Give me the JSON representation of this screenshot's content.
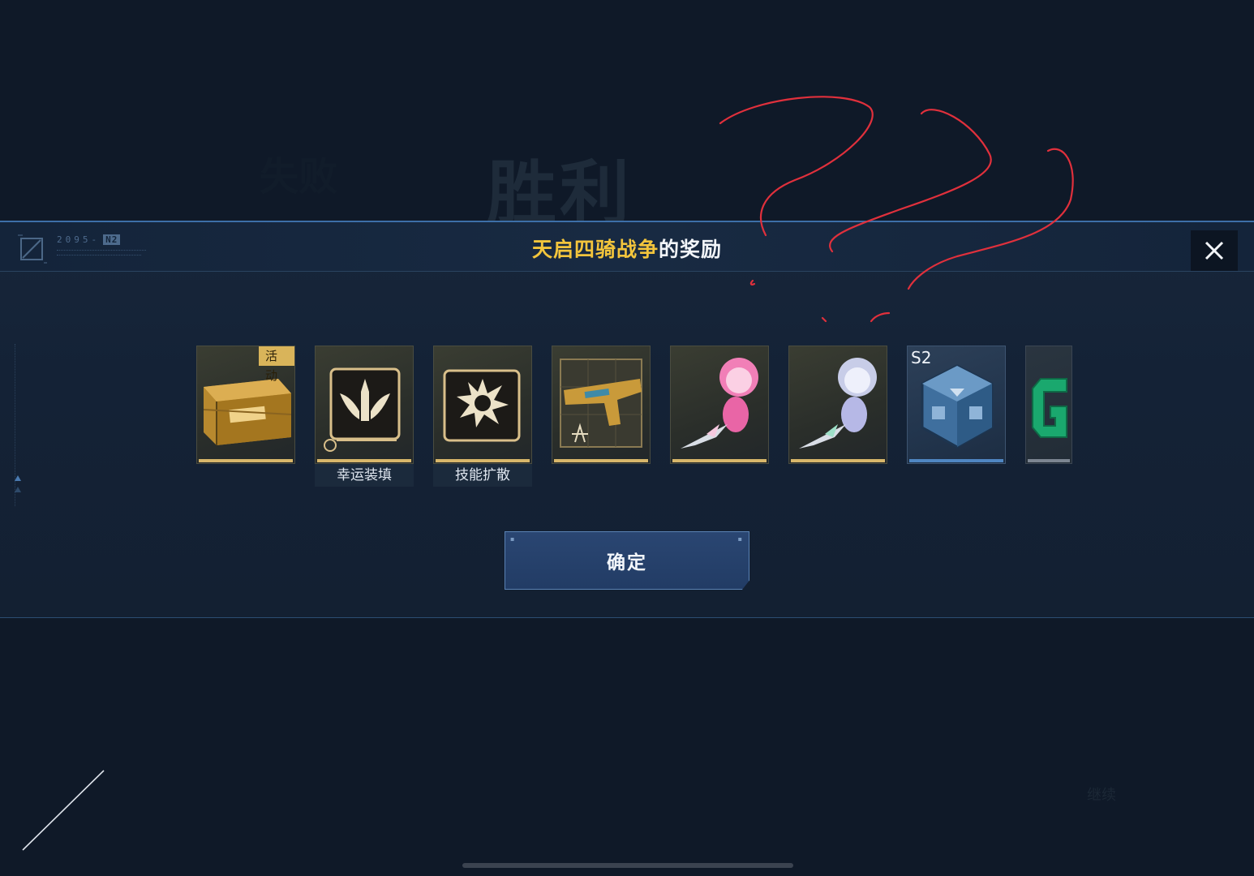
{
  "background": {
    "title": "胜利",
    "title_left": "失败",
    "bottom_text": "继续"
  },
  "header": {
    "code": "2095-",
    "code_tag": "N2",
    "title_highlight": "天启四骑战争",
    "title_rest": "的奖励"
  },
  "rewards": [
    {
      "name": "activity-crate",
      "badge": "活动",
      "label": "",
      "frame": "gold"
    },
    {
      "name": "lucky-reload",
      "badge": "",
      "label": "幸运装填",
      "frame": "gold"
    },
    {
      "name": "skill-spread",
      "badge": "",
      "label": "技能扩散",
      "frame": "gold"
    },
    {
      "name": "weapon-blueprint",
      "badge": "",
      "label": "",
      "frame": "gold"
    },
    {
      "name": "pink-figure",
      "badge": "",
      "label": "",
      "frame": "gold"
    },
    {
      "name": "silver-figure",
      "badge": "",
      "label": "",
      "frame": "gold"
    },
    {
      "name": "s2-core",
      "tier": "S2",
      "label": "",
      "frame": "blue"
    },
    {
      "name": "g-item",
      "badge": "",
      "label": "",
      "frame": "gray"
    }
  ],
  "buttons": {
    "confirm_label": "确定",
    "close_icon": "close-icon"
  },
  "colors": {
    "title_highlight": "#f3c53c",
    "gold_frame": "#d8b66a",
    "blue_frame": "#4f86c2",
    "annotation_red": "#e0303c"
  }
}
